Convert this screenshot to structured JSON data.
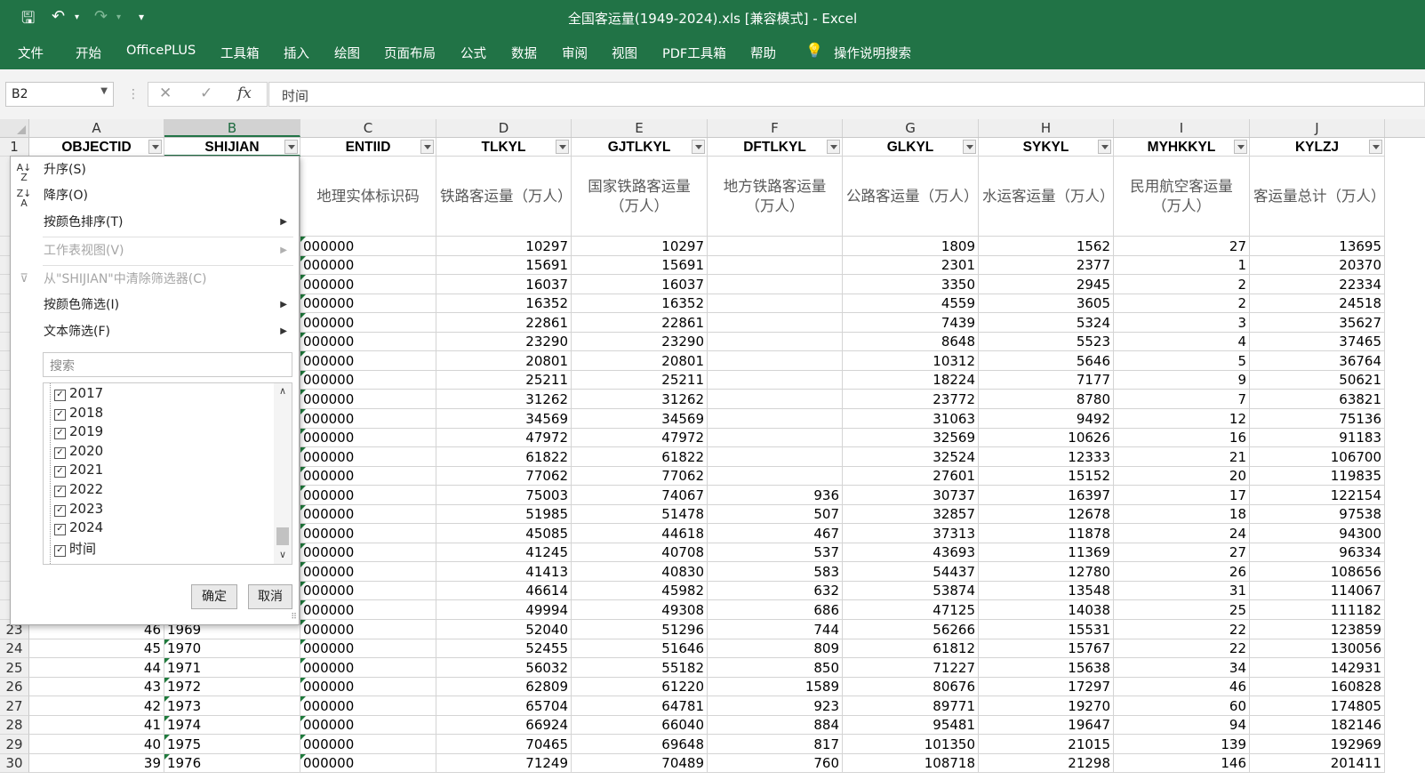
{
  "window": {
    "title": "全国客运量(1949-2024).xls  [兼容模式]  -  Excel"
  },
  "ribbon_tabs": [
    "文件",
    "开始",
    "OfficePLUS",
    "工具箱",
    "插入",
    "绘图",
    "页面布局",
    "公式",
    "数据",
    "审阅",
    "视图",
    "PDF工具箱",
    "帮助",
    "操作说明搜索"
  ],
  "formula_bar": {
    "name_box": "B2",
    "formula": "时间"
  },
  "columns": [
    "A",
    "B",
    "C",
    "D",
    "E",
    "F",
    "G",
    "H",
    "I",
    "J"
  ],
  "header_row": [
    "OBJECTID",
    "SHIJIAN",
    "ENTIID",
    "TLKYL",
    "GJTLKYL",
    "DFTLKYL",
    "GLKYL",
    "SYKYL",
    "MYHKKYL",
    "KYLZJ"
  ],
  "description_row": {
    "C": "地理实体标识码",
    "D": "铁路客运量（万人）",
    "E": "国家铁路客运量（万人）",
    "F": "地方铁路客运量（万人）",
    "G": "公路客运量（万人）",
    "H": "水运客运量（万人）",
    "I": "民用航空客运量（万人）",
    "J": "客运量总计（万人）"
  },
  "row_numbers": [
    "1",
    "23",
    "24",
    "25",
    "26",
    "27",
    "28",
    "29",
    "30"
  ],
  "rows": [
    {
      "A": "",
      "B": "",
      "C": "000000",
      "D": "10297",
      "E": "10297",
      "F": "",
      "G": "1809",
      "H": "1562",
      "I": "27",
      "J": "13695"
    },
    {
      "A": "",
      "B": "",
      "C": "000000",
      "D": "15691",
      "E": "15691",
      "F": "",
      "G": "2301",
      "H": "2377",
      "I": "1",
      "J": "20370"
    },
    {
      "A": "",
      "B": "",
      "C": "000000",
      "D": "16037",
      "E": "16037",
      "F": "",
      "G": "3350",
      "H": "2945",
      "I": "2",
      "J": "22334"
    },
    {
      "A": "",
      "B": "",
      "C": "000000",
      "D": "16352",
      "E": "16352",
      "F": "",
      "G": "4559",
      "H": "3605",
      "I": "2",
      "J": "24518"
    },
    {
      "A": "",
      "B": "",
      "C": "000000",
      "D": "22861",
      "E": "22861",
      "F": "",
      "G": "7439",
      "H": "5324",
      "I": "3",
      "J": "35627"
    },
    {
      "A": "",
      "B": "",
      "C": "000000",
      "D": "23290",
      "E": "23290",
      "F": "",
      "G": "8648",
      "H": "5523",
      "I": "4",
      "J": "37465"
    },
    {
      "A": "",
      "B": "",
      "C": "000000",
      "D": "20801",
      "E": "20801",
      "F": "",
      "G": "10312",
      "H": "5646",
      "I": "5",
      "J": "36764"
    },
    {
      "A": "",
      "B": "",
      "C": "000000",
      "D": "25211",
      "E": "25211",
      "F": "",
      "G": "18224",
      "H": "7177",
      "I": "9",
      "J": "50621"
    },
    {
      "A": "",
      "B": "",
      "C": "000000",
      "D": "31262",
      "E": "31262",
      "F": "",
      "G": "23772",
      "H": "8780",
      "I": "7",
      "J": "63821"
    },
    {
      "A": "",
      "B": "",
      "C": "000000",
      "D": "34569",
      "E": "34569",
      "F": "",
      "G": "31063",
      "H": "9492",
      "I": "12",
      "J": "75136"
    },
    {
      "A": "",
      "B": "",
      "C": "000000",
      "D": "47972",
      "E": "47972",
      "F": "",
      "G": "32569",
      "H": "10626",
      "I": "16",
      "J": "91183"
    },
    {
      "A": "",
      "B": "",
      "C": "000000",
      "D": "61822",
      "E": "61822",
      "F": "",
      "G": "32524",
      "H": "12333",
      "I": "21",
      "J": "106700"
    },
    {
      "A": "",
      "B": "",
      "C": "000000",
      "D": "77062",
      "E": "77062",
      "F": "",
      "G": "27601",
      "H": "15152",
      "I": "20",
      "J": "119835"
    },
    {
      "A": "",
      "B": "",
      "C": "000000",
      "D": "75003",
      "E": "74067",
      "F": "936",
      "G": "30737",
      "H": "16397",
      "I": "17",
      "J": "122154"
    },
    {
      "A": "",
      "B": "",
      "C": "000000",
      "D": "51985",
      "E": "51478",
      "F": "507",
      "G": "32857",
      "H": "12678",
      "I": "18",
      "J": "97538"
    },
    {
      "A": "",
      "B": "",
      "C": "000000",
      "D": "45085",
      "E": "44618",
      "F": "467",
      "G": "37313",
      "H": "11878",
      "I": "24",
      "J": "94300"
    },
    {
      "A": "",
      "B": "",
      "C": "000000",
      "D": "41245",
      "E": "40708",
      "F": "537",
      "G": "43693",
      "H": "11369",
      "I": "27",
      "J": "96334"
    },
    {
      "A": "",
      "B": "",
      "C": "000000",
      "D": "41413",
      "E": "40830",
      "F": "583",
      "G": "54437",
      "H": "12780",
      "I": "26",
      "J": "108656"
    },
    {
      "A": "",
      "B": "",
      "C": "000000",
      "D": "46614",
      "E": "45982",
      "F": "632",
      "G": "53874",
      "H": "13548",
      "I": "31",
      "J": "114067"
    },
    {
      "A": "",
      "B": "",
      "C": "000000",
      "D": "49994",
      "E": "49308",
      "F": "686",
      "G": "47125",
      "H": "14038",
      "I": "25",
      "J": "111182"
    },
    {
      "A": "46",
      "B": "1969",
      "C": "000000",
      "D": "52040",
      "E": "51296",
      "F": "744",
      "G": "56266",
      "H": "15531",
      "I": "22",
      "J": "123859"
    },
    {
      "A": "45",
      "B": "1970",
      "C": "000000",
      "D": "52455",
      "E": "51646",
      "F": "809",
      "G": "61812",
      "H": "15767",
      "I": "22",
      "J": "130056"
    },
    {
      "A": "44",
      "B": "1971",
      "C": "000000",
      "D": "56032",
      "E": "55182",
      "F": "850",
      "G": "71227",
      "H": "15638",
      "I": "34",
      "J": "142931"
    },
    {
      "A": "43",
      "B": "1972",
      "C": "000000",
      "D": "62809",
      "E": "61220",
      "F": "1589",
      "G": "80676",
      "H": "17297",
      "I": "46",
      "J": "160828"
    },
    {
      "A": "42",
      "B": "1973",
      "C": "000000",
      "D": "65704",
      "E": "64781",
      "F": "923",
      "G": "89771",
      "H": "19270",
      "I": "60",
      "J": "174805"
    },
    {
      "A": "41",
      "B": "1974",
      "C": "000000",
      "D": "66924",
      "E": "66040",
      "F": "884",
      "G": "95481",
      "H": "19647",
      "I": "94",
      "J": "182146"
    },
    {
      "A": "40",
      "B": "1975",
      "C": "000000",
      "D": "70465",
      "E": "69648",
      "F": "817",
      "G": "101350",
      "H": "21015",
      "I": "139",
      "J": "192969"
    },
    {
      "A": "39",
      "B": "1976",
      "C": "000000",
      "D": "71249",
      "E": "70489",
      "F": "760",
      "G": "108718",
      "H": "21298",
      "I": "146",
      "J": "201411"
    }
  ],
  "filter_menu": {
    "sort_asc": "升序(S)",
    "sort_desc": "降序(O)",
    "sort_by_color": "按颜色排序(T)",
    "sheet_view": "工作表视图(V)",
    "clear_filter": "从\"SHIJIAN\"中清除筛选器(C)",
    "filter_by_color": "按颜色筛选(I)",
    "text_filter": "文本筛选(F)",
    "search_placeholder": "搜索",
    "list_items": [
      "2017",
      "2018",
      "2019",
      "2020",
      "2021",
      "2022",
      "2023",
      "2024",
      "时间"
    ],
    "ok": "确定",
    "cancel": "取消"
  },
  "colors": {
    "excel_green": "#217346",
    "header_fill": "#efefef",
    "selected_header": "#d2d2d2"
  }
}
